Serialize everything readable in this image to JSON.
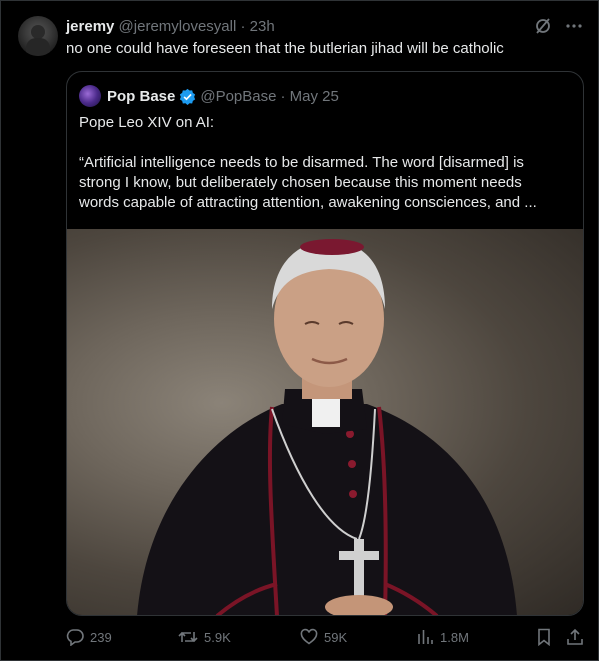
{
  "tweet": {
    "author_name": "jeremy",
    "author_handle": "@jeremylovesyall",
    "time": "· 23h",
    "text": "no one could have foreseen that the butlerian jihad will be catholic"
  },
  "quote": {
    "author_name": "Pop Base",
    "author_handle": "@PopBase",
    "date": "· May 25",
    "line1": "Pope Leo XIV on AI:",
    "line2": "“Artificial intelligence needs to be disarmed. The word [disarmed] is",
    "line3": "strong I know, but deliberately chosen because this moment needs",
    "line4": "words capable of attracting attention, awakening consciences, and ..."
  },
  "actions": {
    "replies": "239",
    "reposts": "5.9K",
    "likes": "59K",
    "views": "1.8M"
  },
  "icons": [
    "grok-slash-icon",
    "more-icon",
    "verified-badge-icon",
    "reply-icon",
    "repost-icon",
    "like-icon",
    "views-icon",
    "bookmark-icon",
    "share-icon"
  ],
  "colors": {
    "background": "#000000",
    "text": "#e7e9ea",
    "muted": "#71767b",
    "border": "#2f3336",
    "verified": "#1d9bf0"
  }
}
